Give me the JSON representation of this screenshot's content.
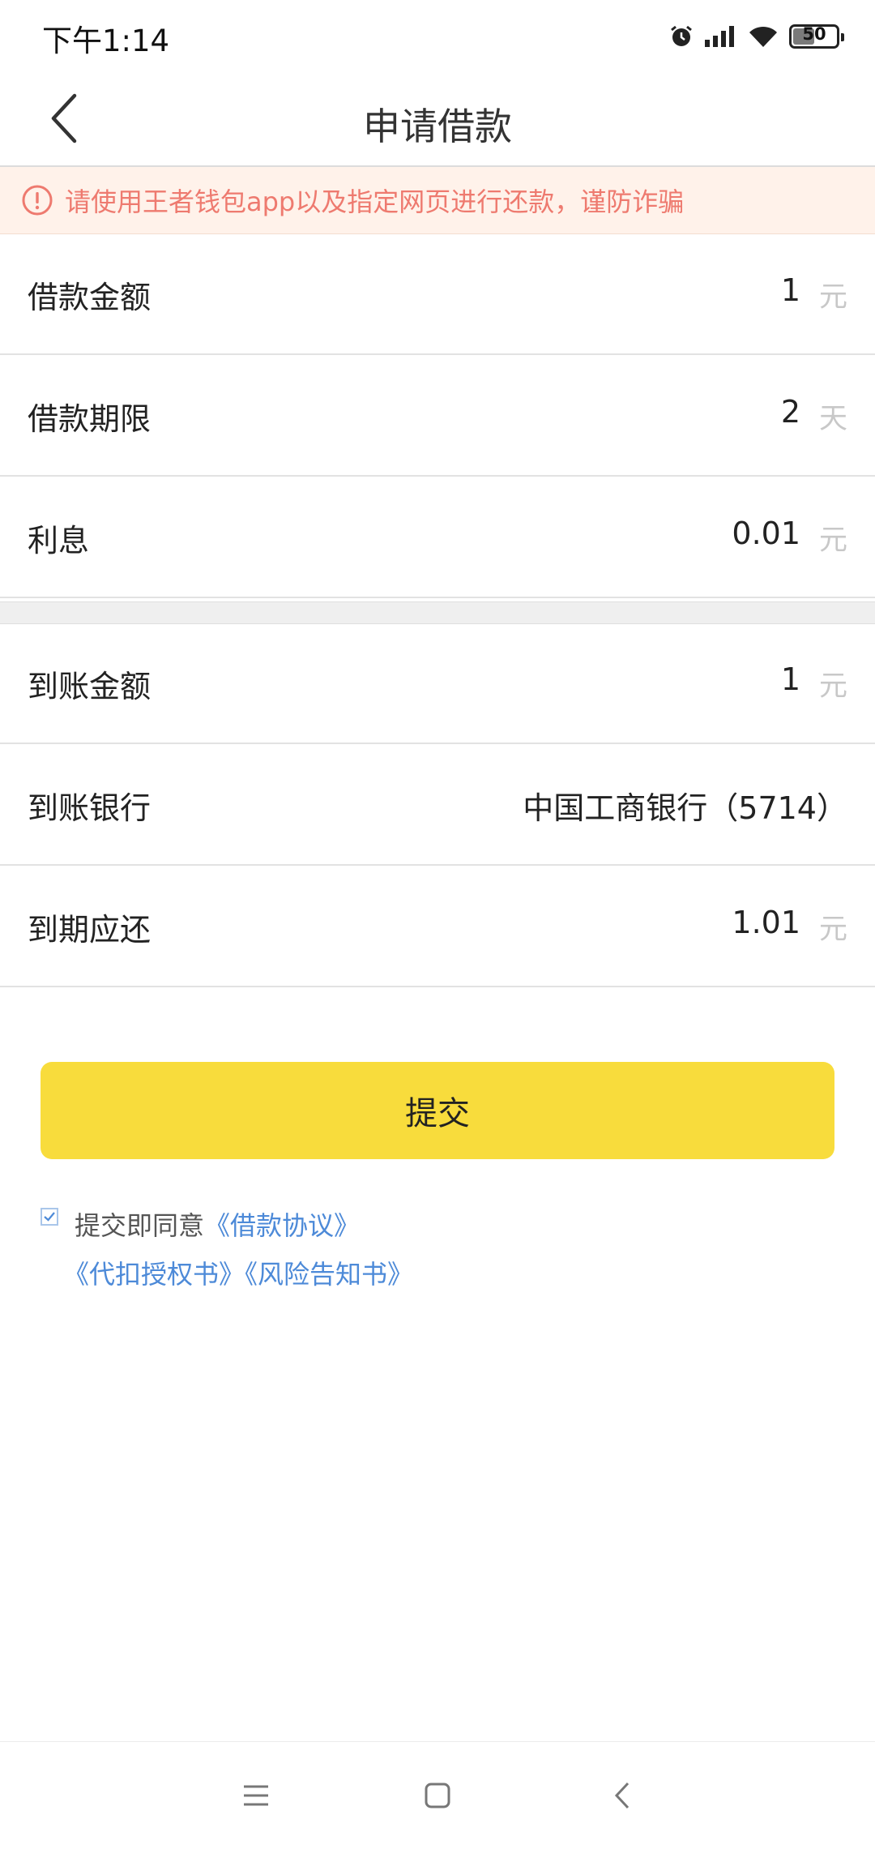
{
  "status_bar": {
    "time": "下午1:14",
    "battery": "50",
    "battery_level": 0.5,
    "icons": [
      "alarm-icon",
      "signal-icon",
      "wifi-icon",
      "battery-icon"
    ]
  },
  "header": {
    "title": "申请借款",
    "back_icon": "chevron-left-icon"
  },
  "notice": {
    "text": "请使用王者钱包app以及指定网页进行还款，谨防诈骗",
    "color": "#ee7a6f",
    "background": "#fff2ea"
  },
  "loan": {
    "amount": {
      "label": "借款金额",
      "value": "1",
      "unit": "元"
    },
    "term": {
      "label": "借款期限",
      "value": "2",
      "unit": "天"
    },
    "interest": {
      "label": "利息",
      "value": "0.01",
      "unit": "元"
    }
  },
  "receipt": {
    "amount": {
      "label": "到账金额",
      "value": "1",
      "unit": "元"
    },
    "bank": {
      "label": "到账银行",
      "value": "中国工商银行（5714）"
    },
    "due": {
      "label": "到期应还",
      "value": "1.01",
      "unit": "元"
    }
  },
  "submit": {
    "label": "提交",
    "color": "#f8dc3c"
  },
  "agreement": {
    "checked": true,
    "prefix": "提交即同意",
    "links": [
      "《借款协议》",
      "《代扣授权书》",
      "《风险告知书》"
    ],
    "link_color": "#4d8ad8"
  },
  "nav": {
    "icons": [
      "menu-icon",
      "home-icon",
      "back-icon"
    ]
  }
}
